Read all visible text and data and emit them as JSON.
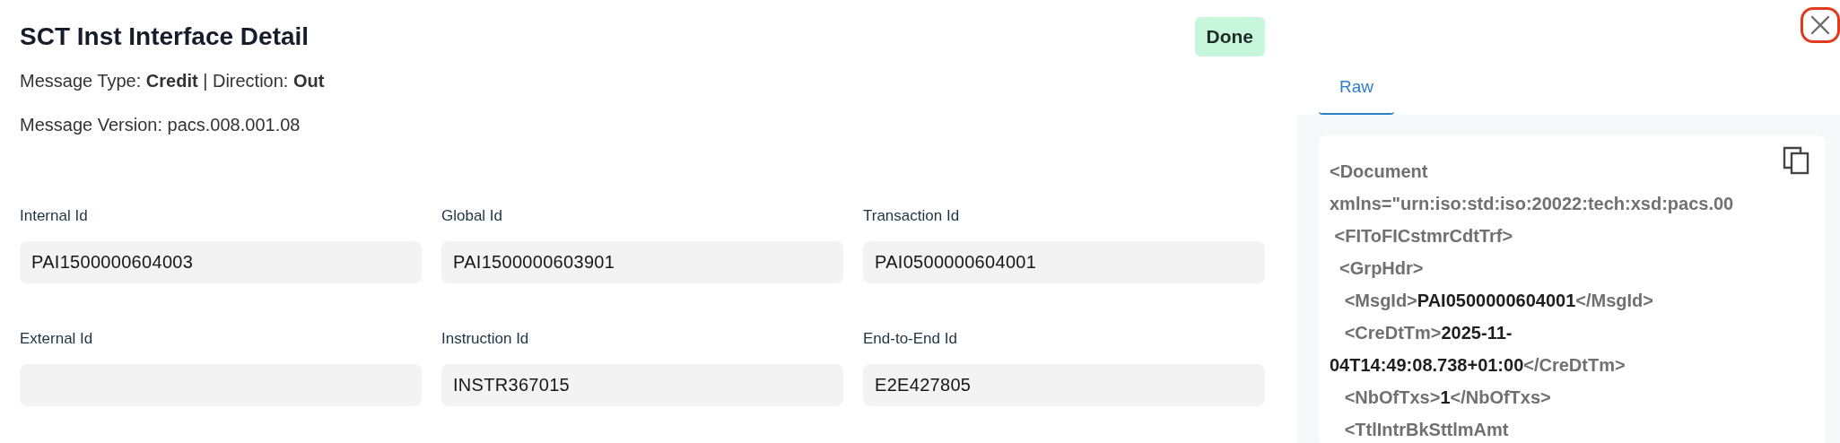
{
  "title": "SCT Inst Interface Detail",
  "status": {
    "label": "Done",
    "kind": "success"
  },
  "meta": [
    "Message Type: **Credit** | Direction: **Out**",
    "Message Version: pacs.008.001.08"
  ],
  "fields": [
    {
      "label": "Internal Id",
      "value": "PAI1500000604003"
    },
    {
      "label": "Global Id",
      "value": "PAI1500000603901"
    },
    {
      "label": "Transaction Id",
      "value": "PAI0500000604001"
    },
    {
      "label": "External Id"
    },
    {
      "label": "Instruction Id",
      "value": "INSTR367015"
    },
    {
      "label": "End-to-End Id",
      "value": "E2E427805"
    }
  ],
  "close_highlighted": true,
  "tabs": [
    {
      "label": "Raw",
      "selected": true
    }
  ],
  "code_lines": [
    {
      "segments": [
        {
          "kind": "tag",
          "text": "<Document"
        }
      ]
    },
    {
      "segments": [
        {
          "kind": "tag",
          "text": "xmlns=\"urn:iso:std:iso:20022:tech:xsd:pacs.00"
        }
      ]
    },
    {
      "segments": [
        {
          "kind": "tag",
          "text": " <FIToFICstmrCdtTrf>"
        }
      ]
    },
    {
      "segments": [
        {
          "kind": "tag",
          "text": "  <GrpHdr>"
        }
      ]
    },
    {
      "segments": [
        {
          "kind": "tag",
          "text": "   <MsgId>"
        },
        {
          "kind": "value",
          "text": "PAI0500000604001"
        },
        {
          "kind": "tag",
          "text": "</MsgId>"
        }
      ]
    },
    {
      "segments": [
        {
          "kind": "tag",
          "text": "   <CreDtTm>"
        },
        {
          "kind": "value",
          "text": "2025-11-"
        }
      ]
    },
    {
      "segments": [
        {
          "kind": "value",
          "text": "04T14:49:08.738+01:00"
        },
        {
          "kind": "tag",
          "text": "</CreDtTm>"
        }
      ]
    },
    {
      "segments": [
        {
          "kind": "tag",
          "text": "   <NbOfTxs>"
        },
        {
          "kind": "value",
          "text": "1"
        },
        {
          "kind": "tag",
          "text": "</NbOfTxs>"
        }
      ]
    },
    {
      "segments": [
        {
          "kind": "tag",
          "text": "   <TtlIntrBkSttlmAmt"
        }
      ]
    }
  ]
}
